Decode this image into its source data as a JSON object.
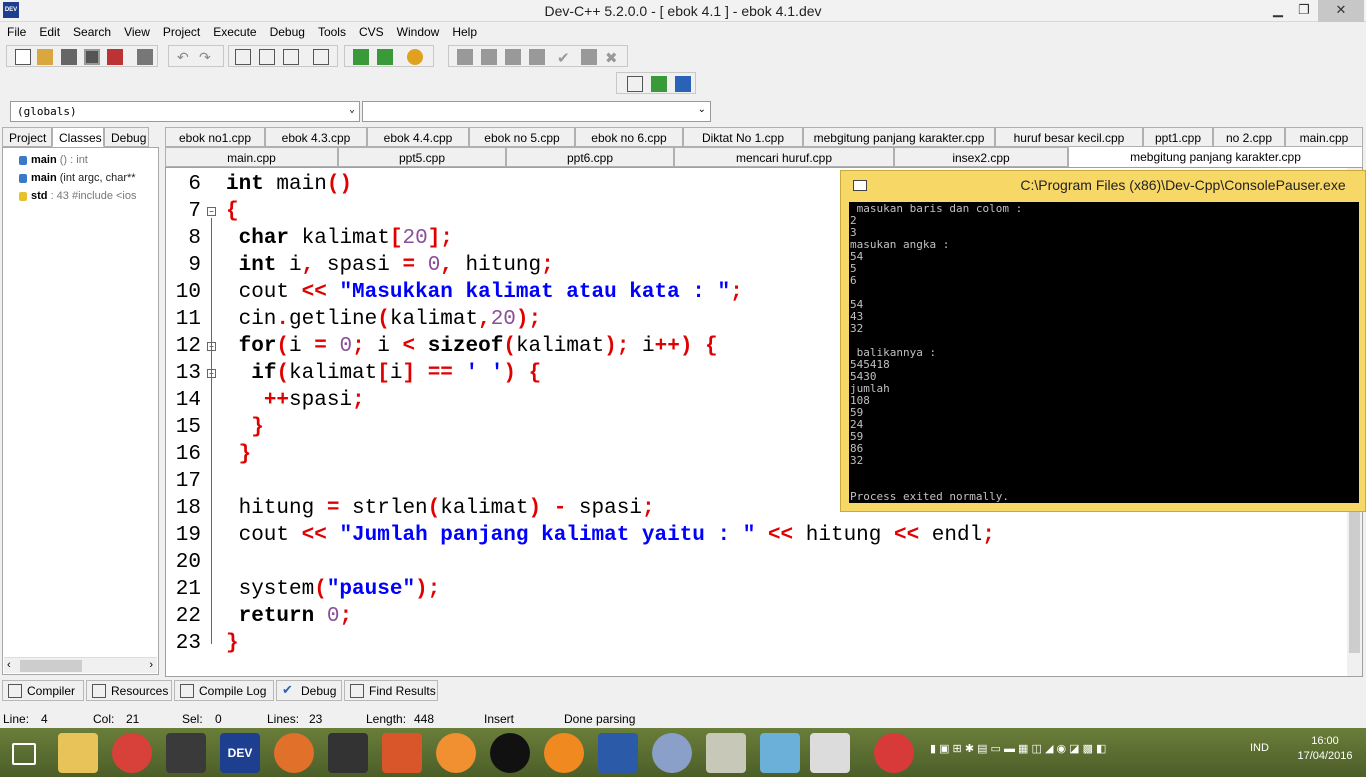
{
  "window": {
    "title": "Dev-C++ 5.2.0.0 - [ ebok 4.1 ] - ebok 4.1.dev",
    "minimize": "▁",
    "restore": "❐",
    "close": "✕"
  },
  "menu": [
    "File",
    "Edit",
    "Search",
    "View",
    "Project",
    "Execute",
    "Debug",
    "Tools",
    "CVS",
    "Window",
    "Help"
  ],
  "scope": {
    "globals": "(globals)",
    "member": ""
  },
  "left_tabs": [
    "Project",
    "Classes",
    "Debug"
  ],
  "class_tree": [
    {
      "name": "main",
      "detail": "() : int"
    },
    {
      "name": "main",
      "detail": "(int argc, char**"
    },
    {
      "name": "std",
      "detail": ": 43 #include <ios"
    }
  ],
  "file_tabs_row1": [
    "ebok no1.cpp",
    "ebok 4.3.cpp",
    "ebok 4.4.cpp",
    "ebok no 5.cpp",
    "ebok no 6.cpp",
    "Diktat No 1.cpp",
    "mebgitung panjang karakter.cpp",
    "huruf besar kecil.cpp",
    "ppt1.cpp",
    "no 2.cpp",
    "main.cpp"
  ],
  "file_tabs_row2": [
    "main.cpp",
    "ppt5.cpp",
    "ppt6.cpp",
    "mencari huruf.cpp",
    "insex2.cpp",
    "mebgitung panjang karakter.cpp"
  ],
  "line_numbers": [
    "6",
    "7",
    "8",
    "9",
    "10",
    "11",
    "12",
    "13",
    "14",
    "15",
    "16",
    "17",
    "18",
    "19",
    "20",
    "21",
    "22",
    "23"
  ],
  "console": {
    "title": "C:\\Program Files (x86)\\Dev-Cpp\\ConsolePauser.exe",
    "output": " masukan baris dan colom :\n2\n3\nmasukan angka :\n54\n5\n6\n\n54\n43\n32\n\n balikannya :\n545418\n5430\njumlah\n108\n59\n24\n59\n86\n32\n\n\nProcess exited normally."
  },
  "bottom_tabs": [
    "Compiler",
    "Resources",
    "Compile Log",
    "Debug",
    "Find Results"
  ],
  "status": {
    "line_label": "Line:",
    "line": "4",
    "col_label": "Col:",
    "col": "21",
    "sel_label": "Sel:",
    "sel": "0",
    "lines_label": "Lines:",
    "lines": "23",
    "length_label": "Length:",
    "length": "448",
    "mode": "Insert",
    "message": "Done parsing"
  },
  "taskbar": {
    "lang": "IND",
    "time": "16:00",
    "date": "17/04/2016"
  }
}
